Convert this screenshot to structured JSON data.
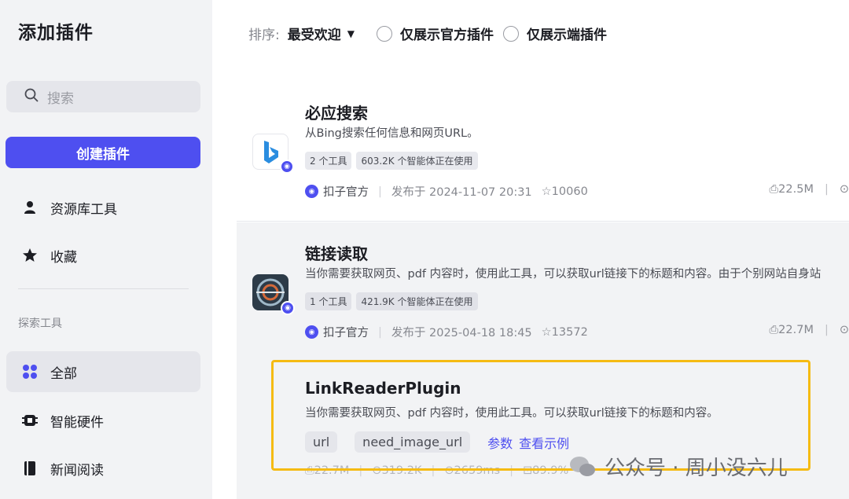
{
  "sidebar": {
    "title": "添加插件",
    "search_placeholder": "搜索",
    "create_label": "创建插件",
    "items": [
      {
        "label": "资源库工具",
        "icon": "person-icon"
      },
      {
        "label": "收藏",
        "icon": "star-icon"
      }
    ],
    "section_label": "探索工具",
    "explore": [
      {
        "label": "全部",
        "icon": "grid-icon",
        "active": true
      },
      {
        "label": "智能硬件",
        "icon": "chip-icon"
      },
      {
        "label": "新闻阅读",
        "icon": "book-icon"
      }
    ]
  },
  "filter": {
    "sort_label": "排序:",
    "sort_value": "最受欢迎",
    "option1": "仅展示官方插件",
    "option2": "仅展示端插件"
  },
  "plugins": [
    {
      "name": "必应搜索",
      "desc": "从Bing搜索任何信息和网页URL。",
      "tools": "2 个工具",
      "usage": "603.2K 个智能体正在使用",
      "publisher": "扣子官方",
      "published": "发布于 2024-11-07 20:31",
      "stars": "10060",
      "calls": "22.5M"
    },
    {
      "name": "链接读取",
      "desc": "当你需要获取网页、pdf 内容时，使用此工具，可以获取url链接下的标题和内容。由于个别网站自身站",
      "tools": "1 个工具",
      "usage": "421.9K 个智能体正在使用",
      "publisher": "扣子官方",
      "published": "发布于 2025-04-18 18:45",
      "stars": "13572",
      "calls": "22.7M"
    }
  ],
  "tool": {
    "name": "LinkReaderPlugin",
    "desc": "当你需要获取网页、pdf 内容时，使用此工具。可以获取url链接下的标题和内容。",
    "params": [
      "url",
      "need_image_url"
    ],
    "param_link": "参数",
    "example_link": "查看示例",
    "stats": [
      "22.7M",
      "319.2K",
      "2659ms",
      "89.9%"
    ]
  },
  "watermark": "公众号 · 周小没六儿",
  "colors": {
    "accent": "#4e4ff0",
    "highlight": "#f5bb13"
  }
}
